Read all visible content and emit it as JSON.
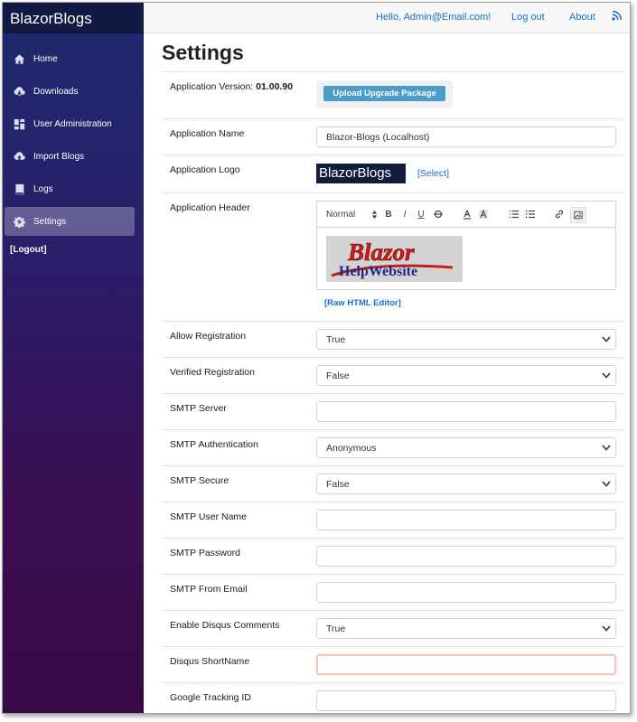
{
  "sidebar": {
    "brand": "BlazorBlogs",
    "items": [
      {
        "label": "Home",
        "icon": "home-icon"
      },
      {
        "label": "Downloads",
        "icon": "cloud-download-icon"
      },
      {
        "label": "User Administration",
        "icon": "dashboard-icon"
      },
      {
        "label": "Import Blogs",
        "icon": "cloud-upload-icon"
      },
      {
        "label": "Logs",
        "icon": "book-icon"
      },
      {
        "label": "Settings",
        "icon": "gear-icon",
        "active": true
      }
    ],
    "logout": "[Logout]"
  },
  "topbar": {
    "greeting": "Hello, Admin@Email.com!",
    "logout": "Log out",
    "about": "About",
    "rss_icon": "rss-icon"
  },
  "page": {
    "title": "Settings",
    "version_label": "Application Version:",
    "version_value": "01.00.90",
    "upgrade_button": "Upload Upgrade Package",
    "app_name_label": "Application Name",
    "app_name_value": "Blazor-Blogs (Localhost)",
    "app_logo_label": "Application Logo",
    "app_logo_text": "BlazorBlogs",
    "select_link": "[Select]",
    "app_header_label": "Application Header",
    "editor": {
      "format_select": "Normal",
      "bold": "B",
      "italic": "I",
      "underline": "U",
      "header_image_line1": "Blazor",
      "header_image_line2": "HelpWebsite"
    },
    "raw_html_link": "[Raw HTML Editor]",
    "fields": [
      {
        "label": "Allow Registration",
        "type": "select",
        "value": "True"
      },
      {
        "label": "Verified Registration",
        "type": "select",
        "value": "False"
      },
      {
        "label": "SMTP Server",
        "type": "text",
        "value": ""
      },
      {
        "label": "SMTP Authentication",
        "type": "select",
        "value": "Anonymous"
      },
      {
        "label": "SMTP Secure",
        "type": "select",
        "value": "False"
      },
      {
        "label": "SMTP User Name",
        "type": "text",
        "value": ""
      },
      {
        "label": "SMTP Password",
        "type": "text",
        "value": ""
      },
      {
        "label": "SMTP From Email",
        "type": "text",
        "value": ""
      },
      {
        "label": "Enable Disqus Comments",
        "type": "select",
        "value": "True"
      },
      {
        "label": "Disqus ShortName",
        "type": "text",
        "value": "",
        "focused": true
      },
      {
        "label": "Google Tracking ID",
        "type": "text",
        "value": ""
      }
    ]
  },
  "colors": {
    "accent_link": "#1b6ec2",
    "upgrade_button": "#4a9cc9",
    "sidebar_top": "#1d2a6c",
    "sidebar_bottom": "#3a0a47",
    "focus_border": "#f4c7bc"
  }
}
